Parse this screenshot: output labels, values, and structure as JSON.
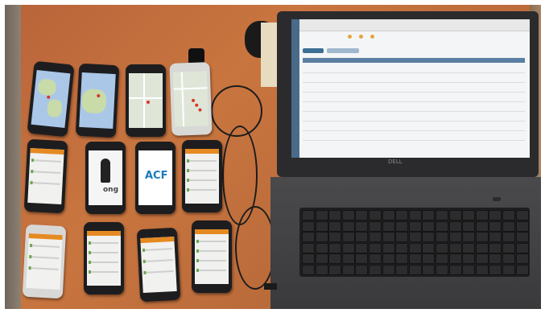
{
  "photo": {
    "phone_logo_1": "ong",
    "phone_logo_2": "ACF",
    "laptop_brand": "DELL"
  }
}
